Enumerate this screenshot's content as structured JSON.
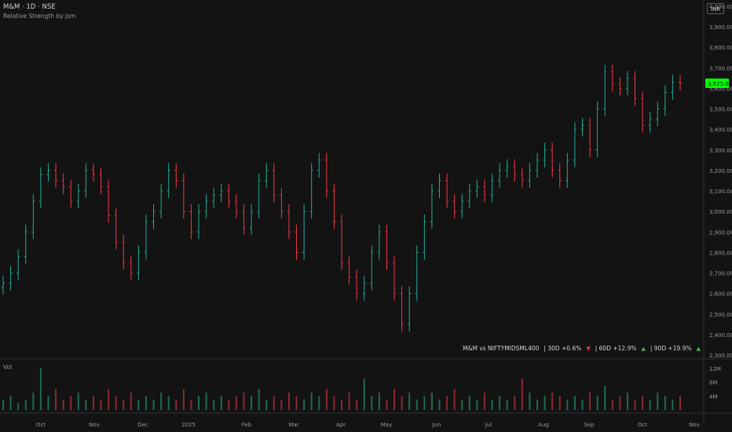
{
  "header": {
    "symbol_title": "M&M · 1D · NSE",
    "indicator_name": "Relative Strength by jsm",
    "currency": "INR"
  },
  "volume_pane": {
    "label": "Vol",
    "ticks": [
      "12M",
      "8M",
      "4M"
    ],
    "tick_values": [
      12000000,
      8000000,
      4000000
    ]
  },
  "relative_strength": {
    "pair": "M&M vs NIFTYMIDSML400",
    "items": [
      {
        "label": "| 30D +0.6%",
        "direction": "down",
        "arrow": "▼"
      },
      {
        "label": "| 60D +12.9%",
        "direction": "up",
        "arrow": "▲"
      },
      {
        "label": "| 90D +19.9%",
        "direction": "up",
        "arrow": "▲"
      }
    ]
  },
  "colors": {
    "up": "#22ab94",
    "down": "#f23645",
    "last_price_bg": "#00ff00",
    "background": "#131313"
  },
  "chart_data": {
    "type": "ohlc",
    "interval": "1D",
    "price_axis": {
      "ticks": [
        "4,000.00",
        "3,900.00",
        "3,800.00",
        "3,700.00",
        "3,600.00",
        "3,500.00",
        "3,400.00",
        "3,300.00",
        "3,200.00",
        "3,100.00",
        "3,000.00",
        "2,900.00",
        "2,800.00",
        "2,700.00",
        "2,600.00",
        "2,500.00",
        "2,400.00",
        "2,300.00"
      ],
      "ylim": [
        2300,
        4000
      ]
    },
    "last_price": {
      "label": "3,625.00",
      "value": 3625
    },
    "time_axis": [
      "Oct",
      "Nov",
      "Dec",
      "2025",
      "Feb",
      "Mar",
      "Apr",
      "May",
      "Jun",
      "Jul",
      "Aug",
      "Sep",
      "Oct",
      "Nov"
    ],
    "series": [
      {
        "name": "Close",
        "values": [
          2650,
          2700,
          2780,
          2900,
          3050,
          3180,
          3200,
          3150,
          3120,
          3050,
          3100,
          3200,
          3180,
          3120,
          2980,
          2850,
          2750,
          2700,
          2800,
          2950,
          3000,
          3100,
          3200,
          3150,
          3000,
          2900,
          3000,
          3050,
          3080,
          3100,
          3050,
          3000,
          2920,
          3000,
          3150,
          3200,
          3080,
          3000,
          2900,
          2800,
          3000,
          3200,
          3250,
          3100,
          2950,
          2750,
          2680,
          2600,
          2650,
          2800,
          2900,
          2750,
          2600,
          2450,
          2600,
          2800,
          2950,
          3100,
          3150,
          3050,
          3000,
          3050,
          3100,
          3120,
          3080,
          3150,
          3200,
          3220,
          3180,
          3150,
          3200,
          3250,
          3300,
          3200,
          3150,
          3250,
          3400,
          3420,
          3300,
          3500,
          3680,
          3620,
          3600,
          3650,
          3550,
          3420,
          3450,
          3500,
          3580,
          3630,
          3625
        ]
      }
    ],
    "volume_note": "daily bars, estimated",
    "volume": [
      3,
      4,
      2,
      3,
      5,
      12,
      4,
      6,
      3,
      4,
      5,
      3,
      4,
      3,
      6,
      4,
      3,
      5,
      3,
      4,
      3,
      5,
      4,
      3,
      6,
      3,
      4,
      5,
      3,
      4,
      3,
      4,
      5,
      4,
      6,
      3,
      4,
      3,
      5,
      4,
      3,
      5,
      4,
      6,
      4,
      3,
      5,
      3,
      9,
      4,
      5,
      3,
      6,
      4,
      5,
      3,
      4,
      5,
      3,
      4,
      6,
      3,
      4,
      3,
      5,
      3,
      4,
      3,
      4,
      9,
      5,
      3,
      4,
      5,
      4,
      3,
      4,
      3,
      5,
      4,
      7,
      3,
      4,
      5,
      3,
      4,
      3,
      5,
      4,
      3,
      4
    ]
  }
}
